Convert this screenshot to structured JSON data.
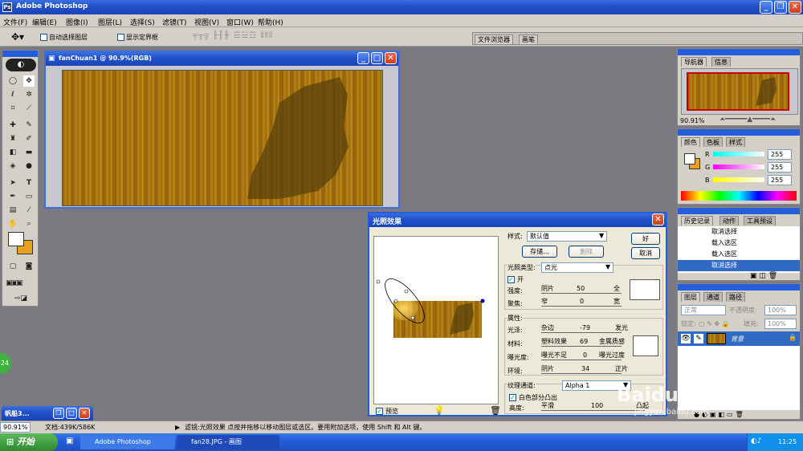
{
  "app": {
    "title": "Adobe Photoshop"
  },
  "menu": [
    "文件(F)",
    "编辑(E)",
    "图像(I)",
    "图层(L)",
    "选择(S)",
    "滤镜(T)",
    "视图(V)",
    "窗口(W)",
    "帮助(H)"
  ],
  "options_bar": {
    "auto_select": "自动选择图层",
    "show_bounds": "显示定界框",
    "tab_browser": "文件浏览器",
    "tab_brush": "画笔"
  },
  "document": {
    "title": "fanChuan1 @ 90.9%(RGB)"
  },
  "navigator": {
    "tab1": "导航器",
    "tab2": "信息",
    "zoom": "90.91%"
  },
  "color_panel": {
    "tab1": "颜色",
    "tab2": "色板",
    "tab3": "样式",
    "r_label": "R",
    "g_label": "G",
    "b_label": "B",
    "r": "255",
    "g": "255",
    "b": "255"
  },
  "history": {
    "tab1": "历史记录",
    "tab2": "动作",
    "tab3": "工具预设",
    "items": [
      "取消选择",
      "载入选区",
      "载入选区",
      "取消选择"
    ]
  },
  "layers": {
    "tab1": "图层",
    "tab2": "通道",
    "tab3": "路径",
    "mode": "正常",
    "opacity_label": "不透明度:",
    "opacity": "100%",
    "lock_label": "锁定:",
    "fill_label": "填充:",
    "fill": "100%",
    "layer_name": "背景"
  },
  "dialog": {
    "title": "光照效果",
    "style_label": "样式:",
    "style_value": "默认值",
    "ok": "好",
    "cancel": "取消",
    "save": "存储...",
    "delete": "删除",
    "light_type_label": "光照类型:",
    "light_type_value": "点光",
    "on": "开",
    "intensity_label": "强度:",
    "intensity_left": "阴片",
    "intensity_value": "50",
    "intensity_right": "全",
    "focus_label": "聚焦:",
    "focus_left": "窄",
    "focus_value": "0",
    "focus_right": "宽",
    "properties_label": "属性:",
    "gloss_label": "光泽:",
    "gloss_left": "杂边",
    "gloss_value": "-79",
    "gloss_right": "发光",
    "material_label": "材料:",
    "material_left": "塑料效果",
    "material_value": "69",
    "material_right": "金属质感",
    "exposure_label": "曝光度:",
    "exposure_left": "曝光不足",
    "exposure_value": "0",
    "exposure_right": "曝光过度",
    "ambience_label": "环境:",
    "ambience_left": "阴片",
    "ambience_value": "34",
    "ambience_right": "正片",
    "texture_label": "纹理通道:",
    "texture_value": "Alpha 1",
    "white_high": "白色部分凸出",
    "height_label": "高度:",
    "height_left": "平滑",
    "height_value": "100",
    "height_right": "凸起",
    "preview": "预览"
  },
  "status": {
    "zoom": "90.91%",
    "doc": "文档:439K/586K",
    "message": "滤镜:光照效果  点按并拖移以移动图层或选区。要用附加选项，使用 Shift 和 Alt 键。"
  },
  "minimized_window": {
    "title": "帆船3..."
  },
  "badge": "24",
  "taskbar": {
    "start": "开始",
    "items": [
      "Adobe Photoshop",
      "fan28.JPG - 画图"
    ],
    "time": "11:25"
  },
  "watermark": {
    "brand": "Baidu 经验",
    "url": "jingyan.baidu.com"
  },
  "colors": {
    "xp_blue": "#245edb",
    "panel": "#d4d0c8",
    "canvas_bg": "#7a7a80",
    "wood": "#a8740f",
    "foreground_swatch": "#ffffff",
    "background_swatch": "#e8a020"
  }
}
